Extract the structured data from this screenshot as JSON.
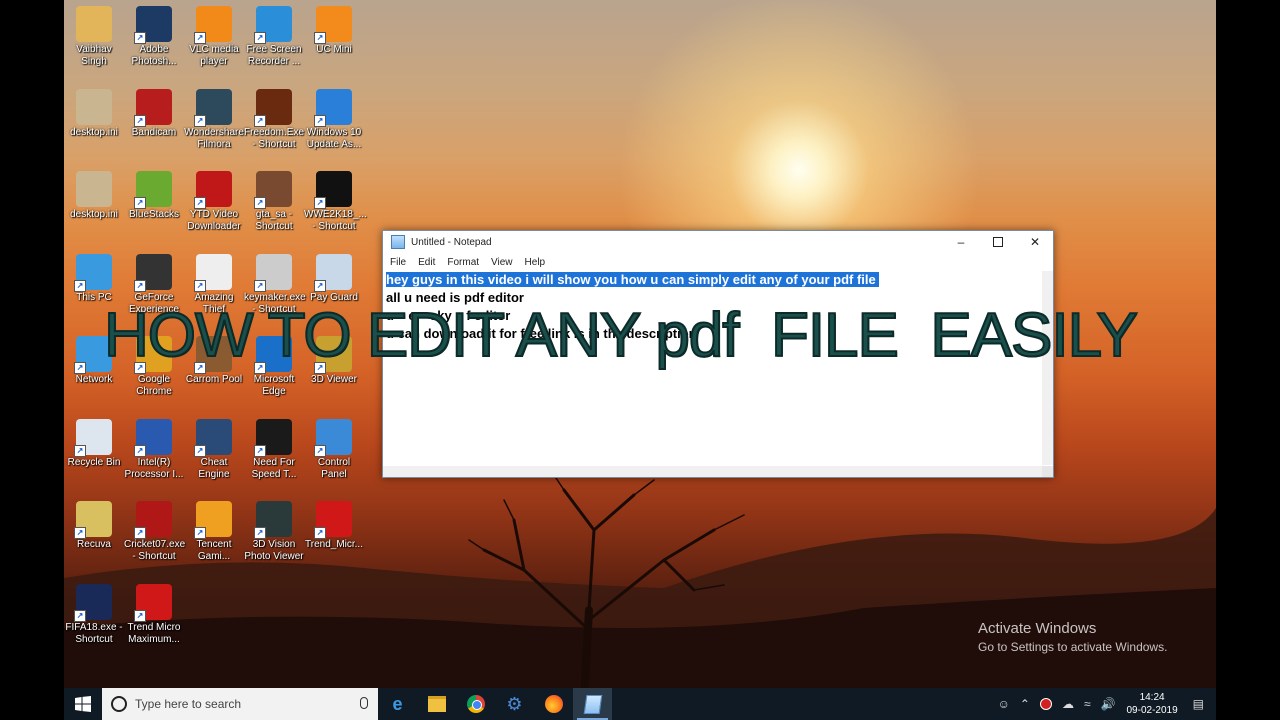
{
  "desktop": {
    "icons": [
      {
        "label": "Vaibhav\nSingh",
        "icon": "user-folder-icon",
        "color": "#e3b55a"
      },
      {
        "label": "Adobe\nPhotosh...",
        "icon": "photoshop-icon",
        "color": "#1c3a64"
      },
      {
        "label": "VLC media\nplayer",
        "icon": "vlc-icon",
        "color": "#f28a1a"
      },
      {
        "label": "Free Screen\nRecorder ...",
        "icon": "screen-recorder-icon",
        "color": "#2a8fd8"
      },
      {
        "label": "UC Mini",
        "icon": "uc-mini-icon",
        "color": "#f38a1c"
      },
      {
        "label": "desktop.ini",
        "icon": "ini-file-icon",
        "color": "#c9b690"
      },
      {
        "label": "Bandicam",
        "icon": "bandicam-icon",
        "color": "#b81d1d"
      },
      {
        "label": "Wondershare\nFilmora",
        "icon": "filmora-icon",
        "color": "#2c4a5c"
      },
      {
        "label": "Freedom.Exe\n- Shortcut",
        "icon": "freedom-icon",
        "color": "#6a2a10"
      },
      {
        "label": "Windows 10\nUpdate As...",
        "icon": "windows-update-icon",
        "color": "#2a7fd8"
      },
      {
        "label": "desktop.ini",
        "icon": "ini-file-icon",
        "color": "#c9b690"
      },
      {
        "label": "BlueStacks",
        "icon": "bluestacks-icon",
        "color": "#6aaa30"
      },
      {
        "label": "YTD Video\nDownloader",
        "icon": "ytd-icon",
        "color": "#c01818"
      },
      {
        "label": "gta_sa -\nShortcut",
        "icon": "gta-icon",
        "color": "#7a4a30"
      },
      {
        "label": "WWE2K18_...\n- Shortcut",
        "icon": "wwe-icon",
        "color": "#111111"
      },
      {
        "label": "This PC",
        "icon": "this-pc-icon",
        "color": "#3a9ae0"
      },
      {
        "label": "GeForce\nExperience",
        "icon": "geforce-icon",
        "color": "#333333"
      },
      {
        "label": "Amazing\nThief",
        "icon": "amazing-thief-icon",
        "color": "#eeeeee"
      },
      {
        "label": "keymaker.exe\n- Shortcut",
        "icon": "keymaker-icon",
        "color": "#cccccc"
      },
      {
        "label": "Pay Guard",
        "icon": "pay-guard-icon",
        "color": "#c8d8e8"
      },
      {
        "label": "Network",
        "icon": "network-icon",
        "color": "#3a9ae0"
      },
      {
        "label": "Google\nChrome",
        "icon": "chrome-icon",
        "color": "#e0a020"
      },
      {
        "label": "Carrom Pool",
        "icon": "carrom-icon",
        "color": "#8a5a30"
      },
      {
        "label": "Microsoft\nEdge",
        "icon": "edge-icon",
        "color": "#1a70c8"
      },
      {
        "label": "3D Viewer",
        "icon": "3d-viewer-icon",
        "color": "#c8a030"
      },
      {
        "label": "Recycle Bin",
        "icon": "recycle-bin-icon",
        "color": "#dde6ee"
      },
      {
        "label": "Intel(R)\nProcessor I...",
        "icon": "intel-icon",
        "color": "#2a5ab0"
      },
      {
        "label": "Cheat Engine",
        "icon": "cheat-engine-icon",
        "color": "#2a4a78"
      },
      {
        "label": "Need For\nSpeed T...",
        "icon": "need-for-speed-icon",
        "color": "#1a1a1a"
      },
      {
        "label": "Control\nPanel",
        "icon": "control-panel-icon",
        "color": "#3a8ad8"
      },
      {
        "label": "Recuva",
        "icon": "recuva-icon",
        "color": "#d8c060"
      },
      {
        "label": "Cricket07.exe\n- Shortcut",
        "icon": "cricket-icon",
        "color": "#b01818"
      },
      {
        "label": "Tencent\nGami...",
        "icon": "tencent-icon",
        "color": "#f0a020"
      },
      {
        "label": "3D Vision\nPhoto Viewer",
        "icon": "3d-vision-icon",
        "color": "#2a3a3a"
      },
      {
        "label": "Trend_Micr...",
        "icon": "trend-micro-icon",
        "color": "#d01818"
      },
      {
        "label": "FIFA18.exe -\nShortcut",
        "icon": "fifa-icon",
        "color": "#1a2a58"
      },
      {
        "label": "Trend Micro\nMaximum...",
        "icon": "trend-micro-max-icon",
        "color": "#d01818"
      }
    ]
  },
  "notepad": {
    "title": "Untitled - Notepad",
    "menu": [
      "File",
      "Edit",
      "Format",
      "View",
      "Help"
    ],
    "lines": [
      "hey guys in this video i will show you how u can simply edit any of your pdf file ",
      "all u need is pdf editor",
      "u    e    sky    f editor",
      "",
      "",
      "u can download it for free link is in the description"
    ]
  },
  "caption": "HOW TO EDIT ANY pdf  FILE  EASILY",
  "watermark": {
    "line1": "Activate Windows",
    "line2": "Go to Settings to activate Windows."
  },
  "taskbar": {
    "search_placeholder": "Type here to search",
    "apps": [
      "edge-icon",
      "file-explorer-icon",
      "chrome-icon",
      "cheat-engine-icon",
      "firefox-icon",
      "notepad-icon"
    ],
    "time": "14:24",
    "date": "09-02-2019"
  }
}
